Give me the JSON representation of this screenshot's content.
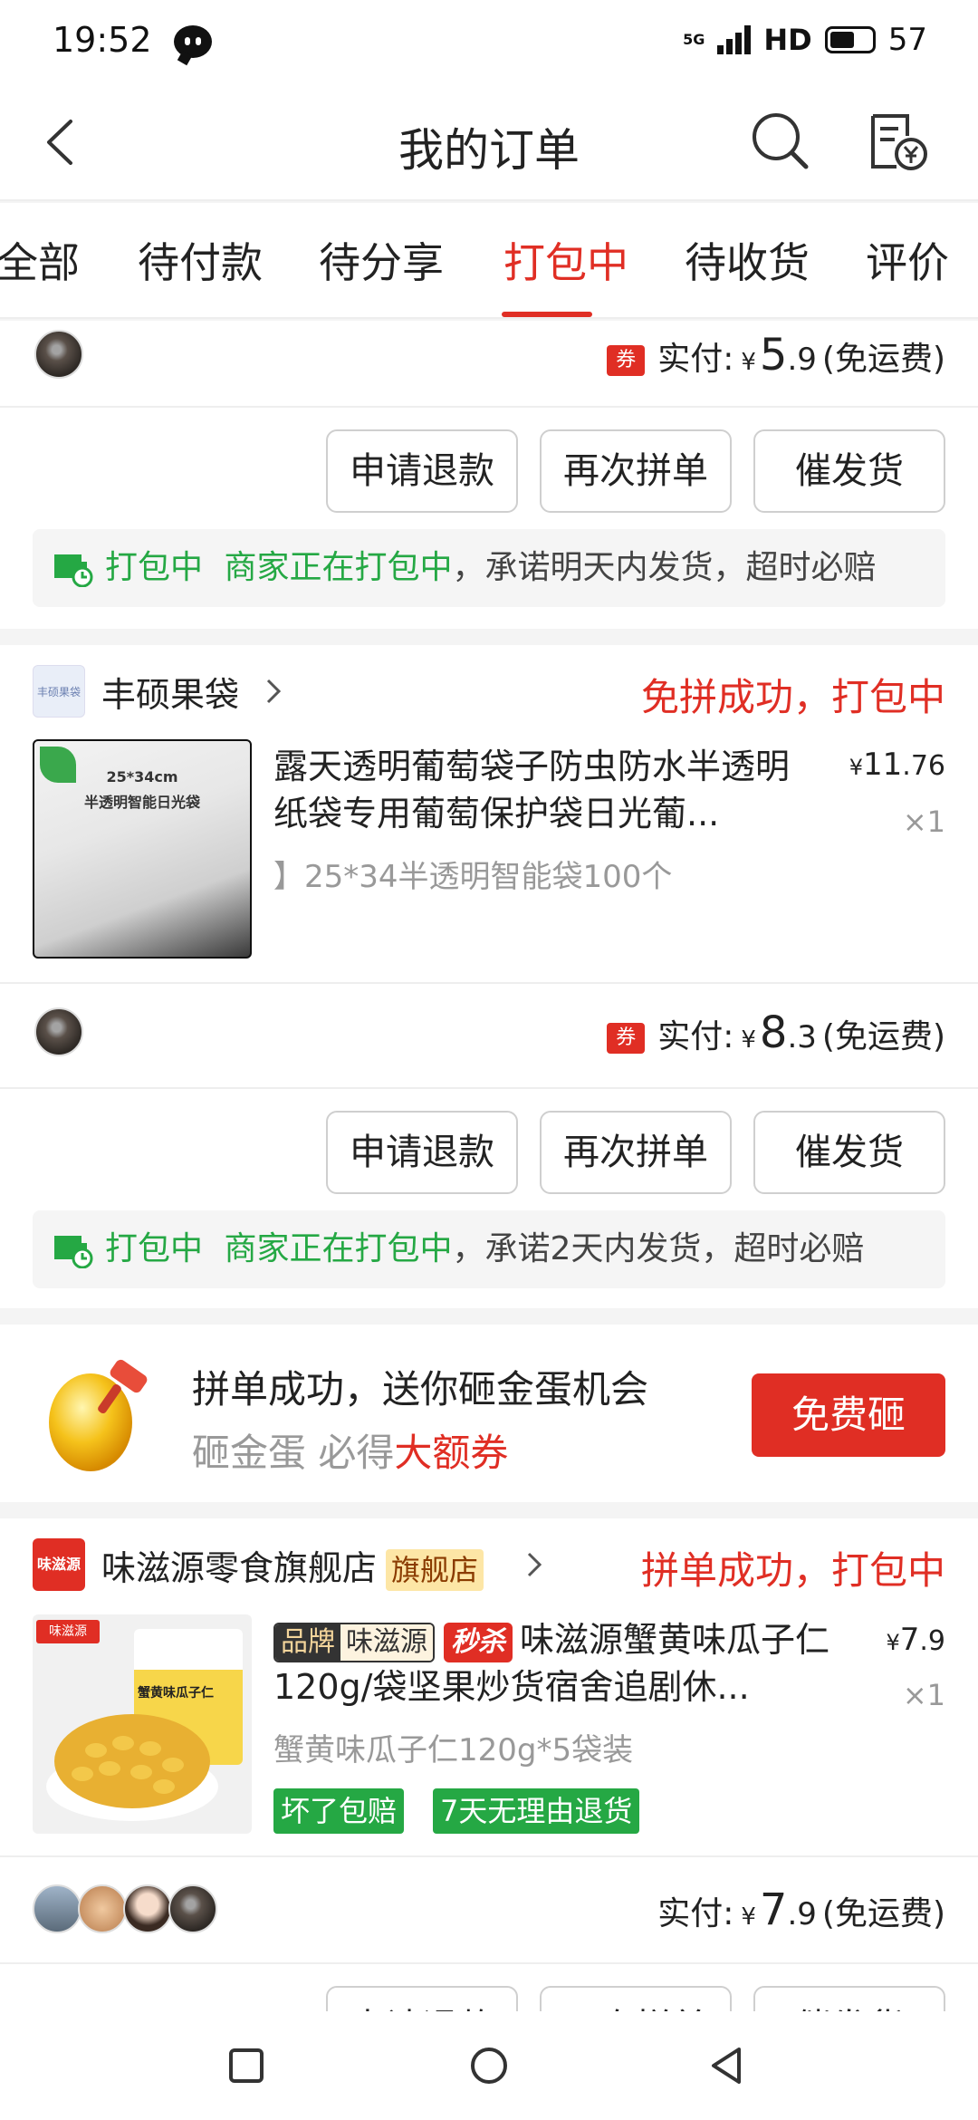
{
  "status_bar": {
    "time": "19:52",
    "network": "5G",
    "hd": "HD",
    "battery": "57"
  },
  "header": {
    "title": "我的订单"
  },
  "tabs": [
    "全部",
    "待付款",
    "待分享",
    "打包中",
    "待收货",
    "评价"
  ],
  "active_tab": "打包中",
  "order1": {
    "paid_label": "实付:",
    "coupon": "券",
    "amount_int": "5",
    "amount_dec": ".9",
    "shipping": "(免运费)",
    "buttons": [
      "申请退款",
      "再次拼单",
      "催发货"
    ],
    "notice_status": "打包中",
    "notice_green": "商家正在打包中",
    "notice_rest": "，承诺明天内发货，超时必赔"
  },
  "order2": {
    "store_name": "丰硕果袋",
    "store_logo_text": "丰硕果袋",
    "status": "免拼成功，打包中",
    "product_title": "露天透明葡萄袋子防虫防水半透明纸袋专用葡萄保护袋日光葡...",
    "product_spec": "】25*34半透明智能袋100个",
    "image_size_text": "25*34cm",
    "image_caption": "半透明智能日光袋",
    "price_int": "11",
    "price_dec": ".76",
    "qty": "×1",
    "paid_label": "实付:",
    "coupon": "券",
    "amount_int": "8",
    "amount_dec": ".3",
    "shipping": "(免运费)",
    "buttons": [
      "申请退款",
      "再次拼单",
      "催发货"
    ],
    "notice_status": "打包中",
    "notice_green": "商家正在打包中",
    "notice_rest": "，承诺2天内发货，超时必赔"
  },
  "promo": {
    "title": "拼单成功，送你砸金蛋机会",
    "sub_gray": "砸金蛋 必得",
    "sub_red": "大额券",
    "button": "免费砸"
  },
  "order3": {
    "store_name": "味滋源零食旗舰店",
    "store_logo_text": "味滋源",
    "flagship": "旗舰店",
    "status": "拼单成功，打包中",
    "tag_brand_a": "品牌",
    "tag_brand_b": "味滋源",
    "tag_flash": "秒杀",
    "product_title": "味滋源蟹黄味瓜子仁120g/袋坚果炒货宿舍追剧休...",
    "product_spec": "蟹黄味瓜子仁120g*5袋装",
    "badges": [
      "坏了包赔",
      "7天无理由退货"
    ],
    "pack_text": "蟹黄味瓜子仁",
    "price_int": "7",
    "price_dec": ".9",
    "qty": "×1",
    "paid_label": "实付:",
    "amount_int": "7",
    "amount_dec": ".9",
    "shipping": "(免运费)",
    "buttons": [
      "申请退款",
      "再次拼单",
      "催发货"
    ]
  },
  "colors": {
    "accent": "#e02e24",
    "green": "#25a844"
  }
}
